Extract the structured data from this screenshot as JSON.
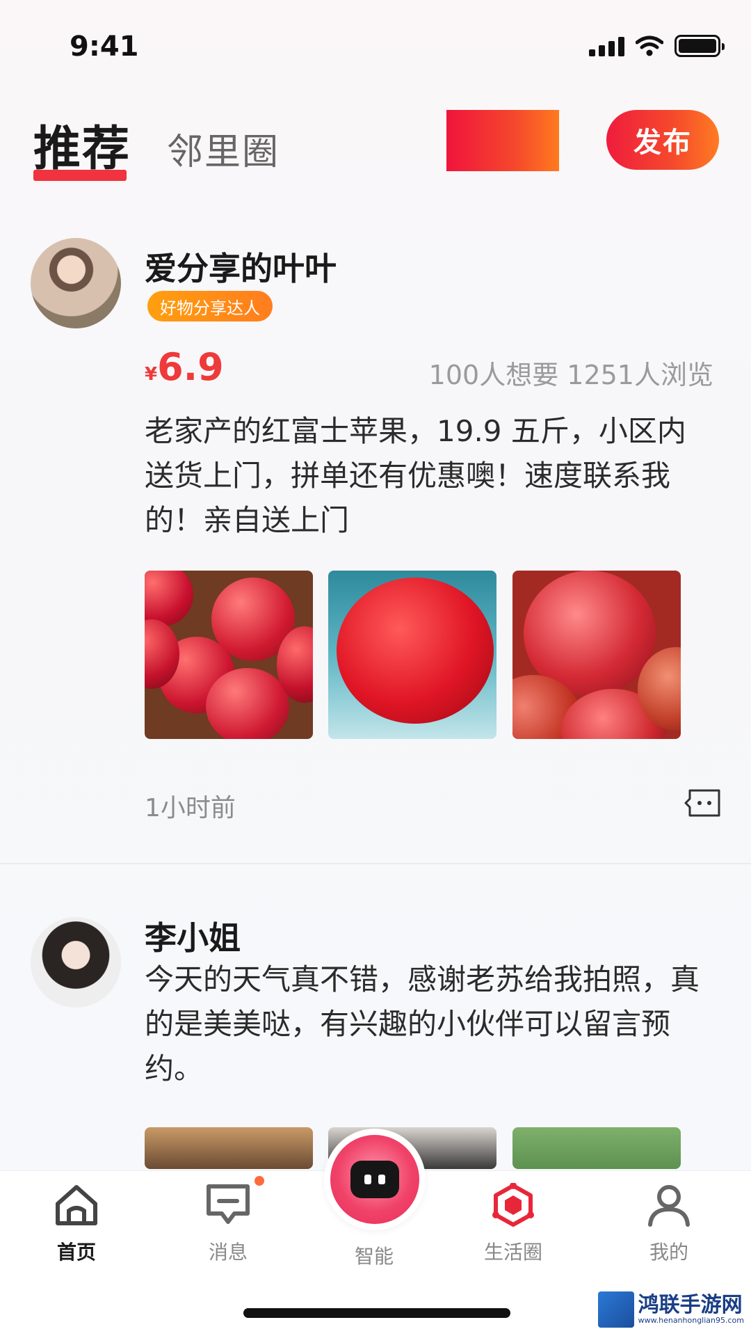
{
  "status_bar": {
    "time": "9:41"
  },
  "header": {
    "tab_active": "推荐",
    "tab_inactive": "邻里圈",
    "publish_label": "发布"
  },
  "posts": [
    {
      "username": "爱分享的叶叶",
      "badge": "好物分享达人",
      "price_symbol": "¥",
      "price": "6.9",
      "stats": "100人想要 1251人浏览",
      "text": "老家产的红富士苹果，19.9 五斤，小区内送货上门，拼单还有优惠噢！速度联系我的！亲自送上门",
      "time": "1小时前",
      "photos": [
        "apples-basket",
        "apple-splash",
        "apples-wet"
      ]
    },
    {
      "username": "李小姐",
      "text": "今天的天气真不错，感谢老苏给我拍照，真的是美美哒，有兴趣的小伙伴可以留言预约。",
      "photos": [
        "portrait-1",
        "portrait-2",
        "green-lawn"
      ]
    }
  ],
  "tabbar": {
    "items": [
      {
        "label": "首页",
        "icon": "home-icon",
        "active": true
      },
      {
        "label": "消息",
        "icon": "message-icon",
        "active": false
      },
      {
        "label": "智能",
        "icon": "robot-icon",
        "active": false
      },
      {
        "label": "生活圈",
        "icon": "life-circle-icon",
        "active": false
      },
      {
        "label": "我的",
        "icon": "profile-icon",
        "active": false
      }
    ]
  },
  "watermark": {
    "name": "鸿联手游网",
    "url": "www.henanhonglian95.com"
  },
  "colors": {
    "accent": "#f0333f",
    "orange": "#ff7d1e",
    "price": "#ee3a3a"
  }
}
